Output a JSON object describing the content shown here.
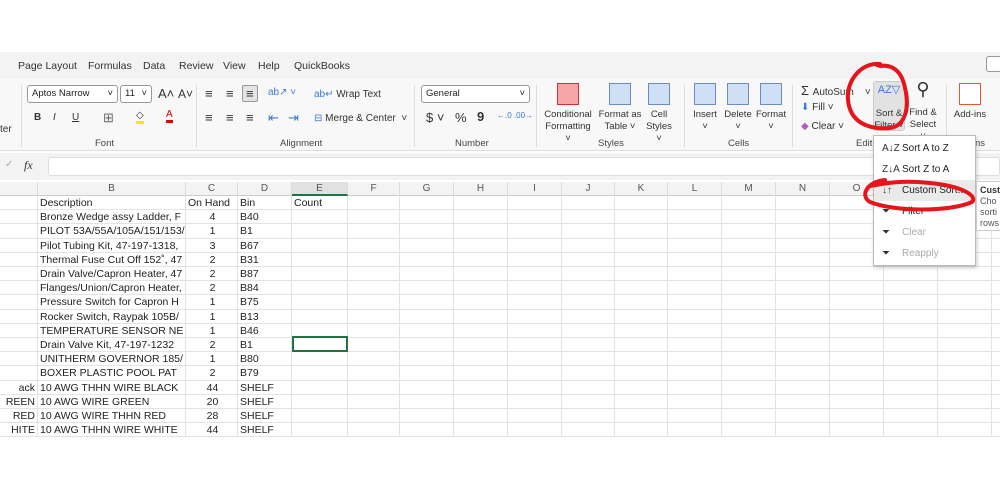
{
  "tabs": [
    "Page Layout",
    "Formulas",
    "Data",
    "Review",
    "View",
    "Help",
    "QuickBooks"
  ],
  "clipboard_fragment": "ter",
  "font": {
    "name": "Aptos Narrow",
    "size": "11",
    "group": "Font",
    "bold": "B",
    "italic": "I",
    "underline": "U"
  },
  "alignment": {
    "wrap": "Wrap Text",
    "merge": "Merge & Center",
    "group": "Alignment"
  },
  "number": {
    "format": "General",
    "group": "Number",
    "currency": "$",
    "percent": "%",
    "comma": "9"
  },
  "styles": {
    "conditional": [
      "Conditional",
      "Formatting ˅"
    ],
    "table": [
      "Format as",
      "Table ˅"
    ],
    "cell": [
      "Cell",
      "Styles ˅"
    ],
    "group": "Styles"
  },
  "cells": {
    "insert": "Insert",
    "delete": "Delete",
    "format": "Format",
    "group": "Cells"
  },
  "editing": {
    "autosum": "AutoSum",
    "fill": "Fill ˅",
    "clear": "Clear ˅",
    "sort": [
      "Sort &",
      "Filter ˅"
    ],
    "find": [
      "Find &",
      "Select ˅"
    ],
    "group": "Editi"
  },
  "addins": {
    "label": "Add-ins",
    "group": "ns"
  },
  "formula_bar": {
    "fx": "fx",
    "value": ""
  },
  "columns": [
    "B",
    "C",
    "D",
    "E",
    "F",
    "G",
    "H",
    "I",
    "J",
    "K",
    "L",
    "M",
    "N",
    "O"
  ],
  "rows": [
    [
      "",
      "Description",
      "On Hand",
      "Bin",
      "Count"
    ],
    [
      "",
      "Bronze Wedge assy Ladder, F",
      "4",
      "B40",
      ""
    ],
    [
      "",
      "PILOT 53A/55A/105A/151/153/",
      "1",
      "B1",
      ""
    ],
    [
      "",
      "Pilot Tubing Kit, 47-197-1318,",
      "3",
      "B67",
      ""
    ],
    [
      "",
      "Thermal Fuse Cut Off 152˚, 47",
      "2",
      "B31",
      ""
    ],
    [
      "",
      "Drain Valve/Capron Heater, 47",
      "2",
      "B87",
      ""
    ],
    [
      "",
      "Flanges/Union/Capron Heater,",
      "2",
      "B84",
      ""
    ],
    [
      "",
      "Pressure Switch for Capron H",
      "1",
      "B75",
      ""
    ],
    [
      "",
      "Rocker Switch, Raypak 105B/",
      "1",
      "B13",
      ""
    ],
    [
      "",
      "TEMPERATURE SENSOR NE",
      "1",
      "B46",
      ""
    ],
    [
      "",
      "Drain Valve Kit, 47-197-1232",
      "2",
      "B1",
      ""
    ],
    [
      "",
      "UNITHERM GOVERNOR 185/",
      "1",
      "B80",
      ""
    ],
    [
      "",
      "BOXER PLASTIC POOL PAT",
      "2",
      "B79",
      ""
    ],
    [
      "ack",
      "10 AWG THHN WIRE BLACK",
      "44",
      "SHELF",
      ""
    ],
    [
      "REEN",
      "10 AWG WIRE GREEN",
      "20",
      "SHELF",
      ""
    ],
    [
      "RED",
      "10 AWG WIRE THHN RED",
      "28",
      "SHELF",
      ""
    ],
    [
      "HITE",
      "10 AWG THHN WIRE WHITE",
      "44",
      "SHELF",
      ""
    ]
  ],
  "menu": [
    {
      "label": "Sort A to Z",
      "icon": "A↓Z"
    },
    {
      "label": "Sort Z to A",
      "icon": "Z↓A"
    },
    {
      "label": "Custom Sort...",
      "icon": "↓↑"
    },
    {
      "label": "Filter",
      "icon": "⏷"
    },
    {
      "label": "Clear",
      "icon": "⏷"
    },
    {
      "label": "Reapply",
      "icon": "⏷"
    }
  ],
  "tooltip": [
    "Cust",
    "Cho",
    "sorti",
    "rows"
  ],
  "annotation_color": "#e8141c"
}
